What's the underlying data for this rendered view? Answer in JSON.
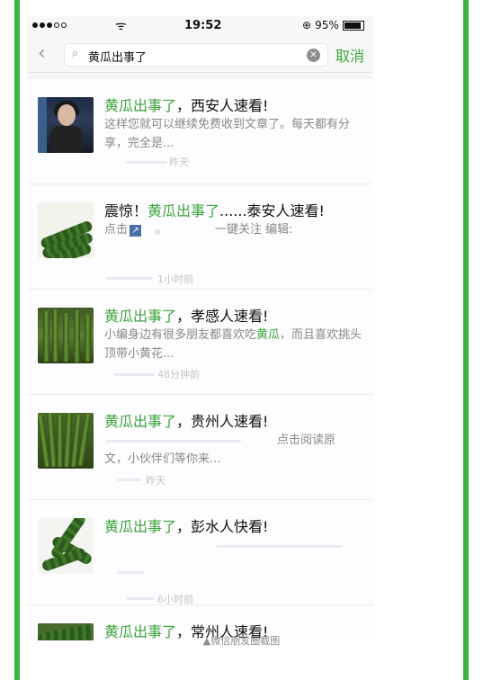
{
  "status_bar": {
    "time": "19:52",
    "battery": "95%"
  },
  "search": {
    "back_icon": "chevron-left-icon",
    "query": "黄瓜出事了",
    "cancel_label": "取消"
  },
  "results": [
    {
      "title_hl": "黄瓜出事了",
      "title_rest": "，西安人速看!",
      "snippet_before": "这样您就可以继续免费收到文章了",
      "snippet_after": "。每天都有分享，完全是...",
      "time": "昨天"
    },
    {
      "title_prefix": "震惊！",
      "title_hl": "黄瓜出事了",
      "title_rest": "......泰安人速看!",
      "snippet_a": "点击",
      "snippet_b": "一键关注 编辑:",
      "time": "1小时前"
    },
    {
      "title_hl": "黄瓜出事了",
      "title_rest": "，孝感人速看!",
      "snippet_before": "小编身边有很多朋友都喜欢吃",
      "snippet_hl": "黄瓜",
      "snippet_after": "，而且喜欢挑头顶带小黄花...",
      "time": "48分钟前"
    },
    {
      "title_hl": "黄瓜出事了",
      "title_rest": "，贵州人速看!",
      "snippet_a": "点击阅读原",
      "snippet_b": "文，小伙伴们等你来...",
      "time": "昨天"
    },
    {
      "title_hl": "黄瓜出事了",
      "title_rest": "，彭水人快看!",
      "time": "6小时前"
    },
    {
      "title_hl": "黄瓜出事了",
      "title_rest": "，常州人速看!"
    }
  ],
  "caption": "▲微信朋友圈截图"
}
